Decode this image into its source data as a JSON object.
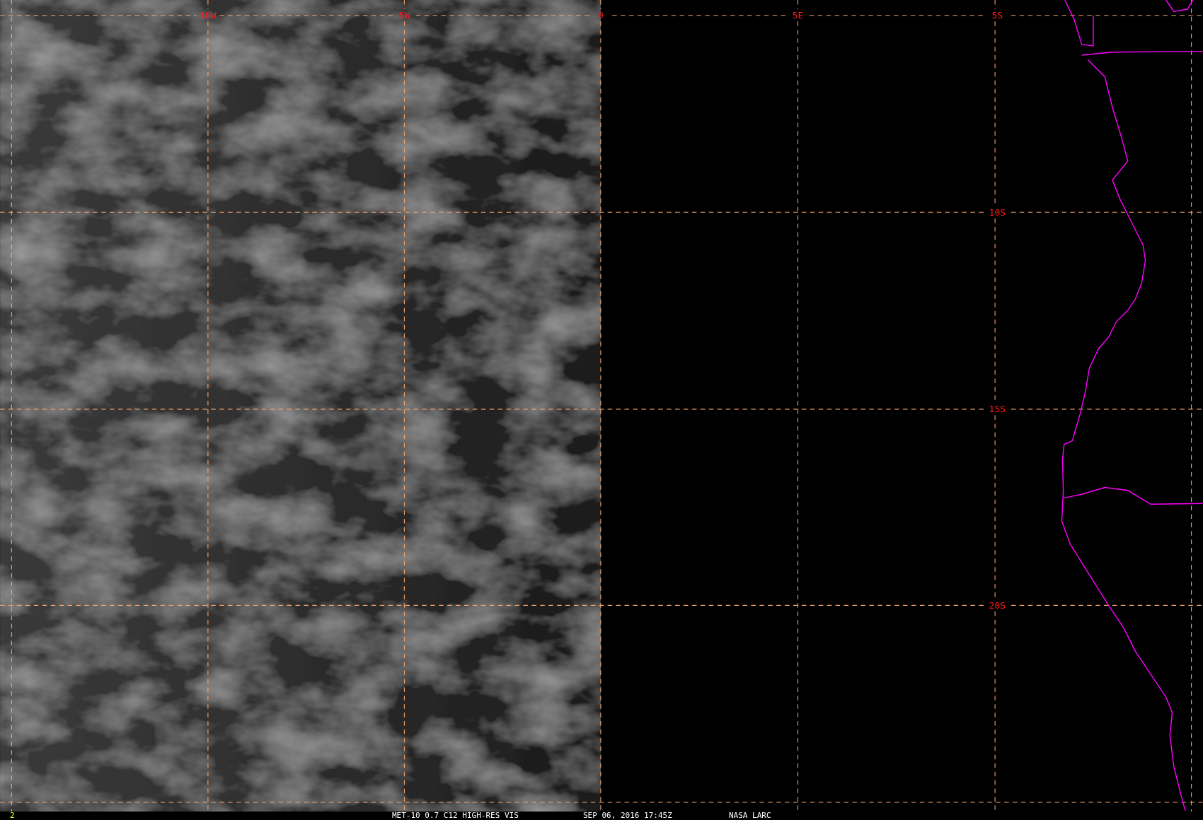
{
  "map": {
    "lon_labels": [
      "10W",
      "5W",
      "0",
      "5E"
    ],
    "lat_labels": [
      "5S",
      "10S",
      "15S",
      "20S"
    ]
  },
  "status_bar": {
    "frame": "2",
    "caption": "MET-10 0.7 C12 HIGH-RES VIS",
    "time": "SEP 06, 2016 17:45Z",
    "source": "NASA LARC"
  }
}
